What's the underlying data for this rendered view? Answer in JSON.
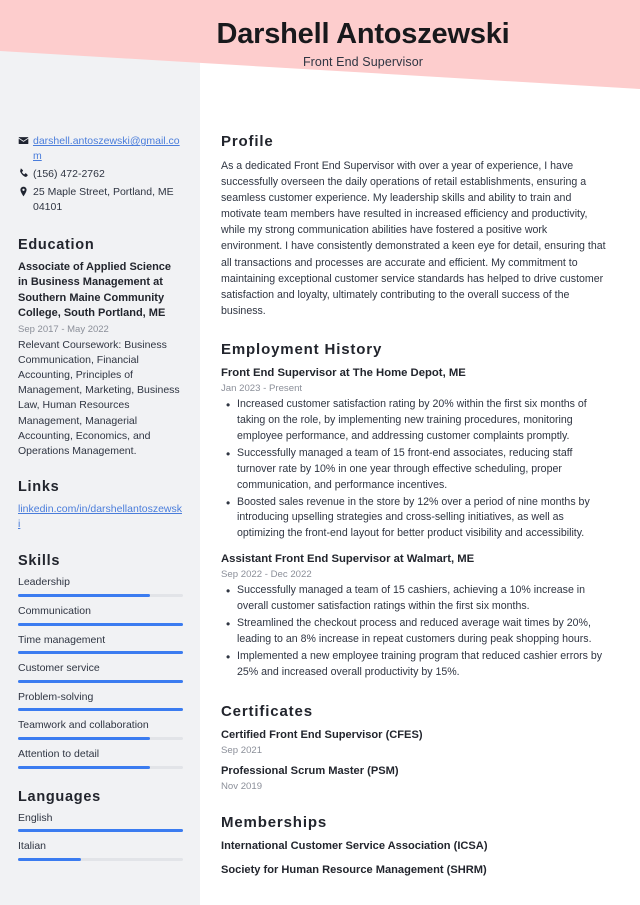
{
  "header": {
    "name": "Darshell Antoszewski",
    "job_title": "Front End Supervisor",
    "band_color": "#fdcdcd"
  },
  "theme": {
    "sidebar_bg": "#f1f2f4",
    "accent_blue": "#3b7cf0",
    "link_blue": "#4a7ddb",
    "heading_color": "#22252d",
    "muted_text": "#8b8f99"
  },
  "sidebar": {
    "contact": [
      {
        "icon": "envelope-icon",
        "text": "darshell.antoszewski@gmail.com",
        "is_link": true
      },
      {
        "icon": "phone-icon",
        "text": "(156) 472-2762",
        "is_link": false
      },
      {
        "icon": "location-pin-icon",
        "text": "25 Maple Street, Portland, ME 04101",
        "is_link": false
      }
    ],
    "education": {
      "heading": "Education",
      "degree": "Associate of Applied Science in Business Management at Southern Maine Community College, South Portland, ME",
      "date": "Sep 2017 - May 2022",
      "description": "Relevant Coursework: Business Communication, Financial Accounting, Principles of Management, Marketing, Business Law, Human Resources Management, Managerial Accounting, Economics, and Operations Management."
    },
    "links": {
      "heading": "Links",
      "items": [
        {
          "label": "linkedin.com/in/darshellantoszewski"
        }
      ]
    },
    "skills": {
      "heading": "Skills",
      "items": [
        {
          "label": "Leadership",
          "level": 80
        },
        {
          "label": "Communication",
          "level": 100
        },
        {
          "label": "Time management",
          "level": 100
        },
        {
          "label": "Customer service",
          "level": 100
        },
        {
          "label": "Problem-solving",
          "level": 100
        },
        {
          "label": "Teamwork and collaboration",
          "level": 80
        },
        {
          "label": "Attention to detail",
          "level": 80
        }
      ]
    },
    "languages": {
      "heading": "Languages",
      "items": [
        {
          "label": "English",
          "level": 100
        },
        {
          "label": "Italian",
          "level": 38
        }
      ]
    }
  },
  "main": {
    "profile": {
      "heading": "Profile",
      "text": "As a dedicated Front End Supervisor with over a year of experience, I have successfully overseen the daily operations of retail establishments, ensuring a seamless customer experience. My leadership skills and ability to train and motivate team members have resulted in increased efficiency and productivity, while my strong communication abilities have fostered a positive work environment. I have consistently demonstrated a keen eye for detail, ensuring that all transactions and processes are accurate and efficient. My commitment to maintaining exceptional customer service standards has helped to drive customer satisfaction and loyalty, ultimately contributing to the overall success of the business."
    },
    "employment": {
      "heading": "Employment History",
      "jobs": [
        {
          "title": "Front End Supervisor at The Home Depot, ME",
          "date": "Jan 2023 - Present",
          "bullets": [
            "Increased customer satisfaction rating by 20% within the first six months of taking on the role, by implementing new training procedures, monitoring employee performance, and addressing customer complaints promptly.",
            "Successfully managed a team of 15 front-end associates, reducing staff turnover rate by 10% in one year through effective scheduling, proper communication, and performance incentives.",
            "Boosted sales revenue in the store by 12% over a period of nine months by introducing upselling strategies and cross-selling initiatives, as well as optimizing the front-end layout for better product visibility and accessibility."
          ]
        },
        {
          "title": "Assistant Front End Supervisor at Walmart, ME",
          "date": "Sep 2022 - Dec 2022",
          "bullets": [
            "Successfully managed a team of 15 cashiers, achieving a 10% increase in overall customer satisfaction ratings within the first six months.",
            "Streamlined the checkout process and reduced average wait times by 20%, leading to an 8% increase in repeat customers during peak shopping hours.",
            "Implemented a new employee training program that reduced cashier errors by 25% and increased overall productivity by 15%."
          ]
        }
      ]
    },
    "certificates": {
      "heading": "Certificates",
      "items": [
        {
          "name": "Certified Front End Supervisor (CFES)",
          "date": "Sep 2021"
        },
        {
          "name": "Professional Scrum Master (PSM)",
          "date": "Nov 2019"
        }
      ]
    },
    "memberships": {
      "heading": "Memberships",
      "items": [
        {
          "name": "International Customer Service Association (ICSA)"
        },
        {
          "name": "Society for Human Resource Management (SHRM)"
        }
      ]
    }
  }
}
